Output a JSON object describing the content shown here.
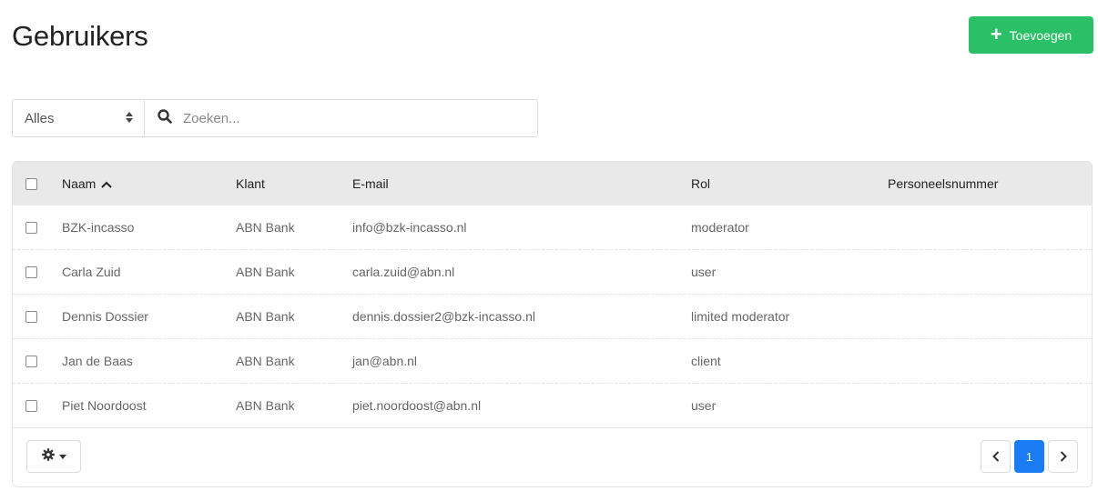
{
  "page": {
    "title": "Gebruikers"
  },
  "actions": {
    "add_label": "Toevoegen",
    "add_icon": "plus-icon"
  },
  "filter": {
    "selected": "Alles",
    "search_placeholder": "Zoeken...",
    "search_value": ""
  },
  "table": {
    "columns": [
      "Naam",
      "Klant",
      "E-mail",
      "Rol",
      "Personeelsnummer"
    ],
    "rows": [
      {
        "name": "BZK-incasso",
        "client": "ABN Bank",
        "email": "info@bzk-incasso.nl",
        "role": "moderator",
        "pnr": ""
      },
      {
        "name": "Carla Zuid",
        "client": "ABN Bank",
        "email": "carla.zuid@abn.nl",
        "role": "user",
        "pnr": ""
      },
      {
        "name": "Dennis Dossier",
        "client": "ABN Bank",
        "email": "dennis.dossier2@bzk-incasso.nl",
        "role": "limited moderator",
        "pnr": ""
      },
      {
        "name": "Jan de Baas",
        "client": "ABN Bank",
        "email": "jan@abn.nl",
        "role": "client",
        "pnr": ""
      },
      {
        "name": "Piet Noordoost",
        "client": "ABN Bank",
        "email": "piet.noordoost@abn.nl",
        "role": "user",
        "pnr": ""
      }
    ]
  },
  "pagination": {
    "current_page": "1"
  },
  "colors": {
    "accent_green": "#2bc067",
    "accent_blue": "#1a7cf2",
    "header_bg": "#e9e9e9"
  }
}
